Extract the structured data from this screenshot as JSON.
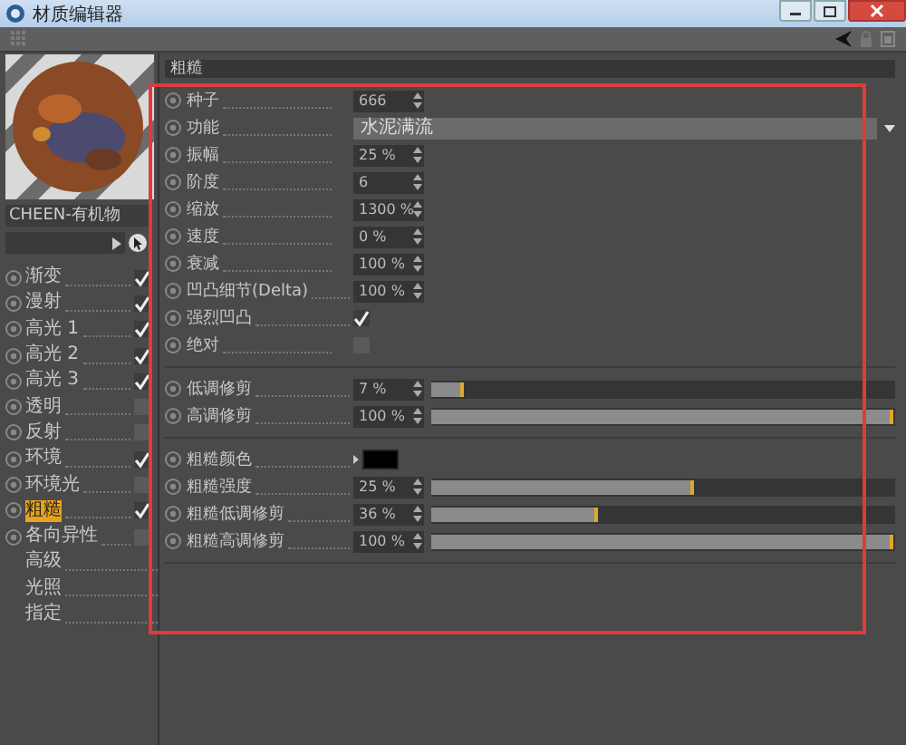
{
  "window": {
    "title": "材质编辑器"
  },
  "material_name": "CHEEN-有机物",
  "channels": [
    {
      "kind": "channel",
      "label": "渐变",
      "checked": true,
      "selected": false
    },
    {
      "kind": "channel",
      "label": "漫射",
      "checked": true,
      "selected": false
    },
    {
      "kind": "channel",
      "label": "高光 1",
      "checked": true,
      "selected": false
    },
    {
      "kind": "channel",
      "label": "高光 2",
      "checked": true,
      "selected": false
    },
    {
      "kind": "channel",
      "label": "高光 3",
      "checked": true,
      "selected": false
    },
    {
      "kind": "channel",
      "label": "透明",
      "checked": false,
      "selected": false
    },
    {
      "kind": "channel",
      "label": "反射",
      "checked": false,
      "selected": false
    },
    {
      "kind": "channel",
      "label": "环境",
      "checked": true,
      "selected": false
    },
    {
      "kind": "channel",
      "label": "环境光",
      "checked": false,
      "selected": false
    },
    {
      "kind": "channel",
      "label": "粗糙",
      "checked": true,
      "selected": true
    },
    {
      "kind": "channel",
      "label": "各向异性",
      "checked": false,
      "selected": false
    },
    {
      "kind": "plain",
      "label": "高级",
      "selected": false
    },
    {
      "kind": "plain",
      "label": "光照",
      "selected": false
    },
    {
      "kind": "plain",
      "label": "指定",
      "selected": false
    }
  ],
  "section_title": "粗糙",
  "highlight_frame": true,
  "groups": [
    {
      "rows": [
        {
          "kind": "number",
          "label": "种子",
          "value": "666"
        },
        {
          "kind": "dropdown",
          "label": "功能",
          "value": "水泥满流"
        },
        {
          "kind": "number",
          "label": "振幅",
          "value": "25 %"
        },
        {
          "kind": "number",
          "label": "阶度",
          "value": "6"
        },
        {
          "kind": "number",
          "label": "缩放",
          "value": "1300 %"
        },
        {
          "kind": "number",
          "label": "速度",
          "value": "0 %"
        },
        {
          "kind": "number",
          "label": "衰减",
          "value": "100 %"
        },
        {
          "kind": "number",
          "label": "凹凸细节(Delta)",
          "value": "100 %"
        },
        {
          "kind": "checkbox",
          "label": "强烈凹凸",
          "checked": true
        },
        {
          "kind": "checkbox",
          "label": "绝对",
          "checked": false
        }
      ]
    },
    {
      "rows": [
        {
          "kind": "slider",
          "label": "低调修剪",
          "value": "7 %",
          "level": 0.07
        },
        {
          "kind": "slider",
          "label": "高调修剪",
          "value": "100 %",
          "level": 1
        }
      ]
    },
    {
      "rows": [
        {
          "kind": "color",
          "label": "粗糙颜色",
          "color": "#000000"
        },
        {
          "kind": "slider",
          "label": "粗糙强度",
          "value": "25 %",
          "level": 0.57
        },
        {
          "kind": "slider",
          "label": "粗糙低调修剪",
          "value": "36 %",
          "level": 0.36
        },
        {
          "kind": "slider",
          "label": "粗糙高调修剪",
          "value": "100 %",
          "level": 1
        }
      ]
    }
  ]
}
